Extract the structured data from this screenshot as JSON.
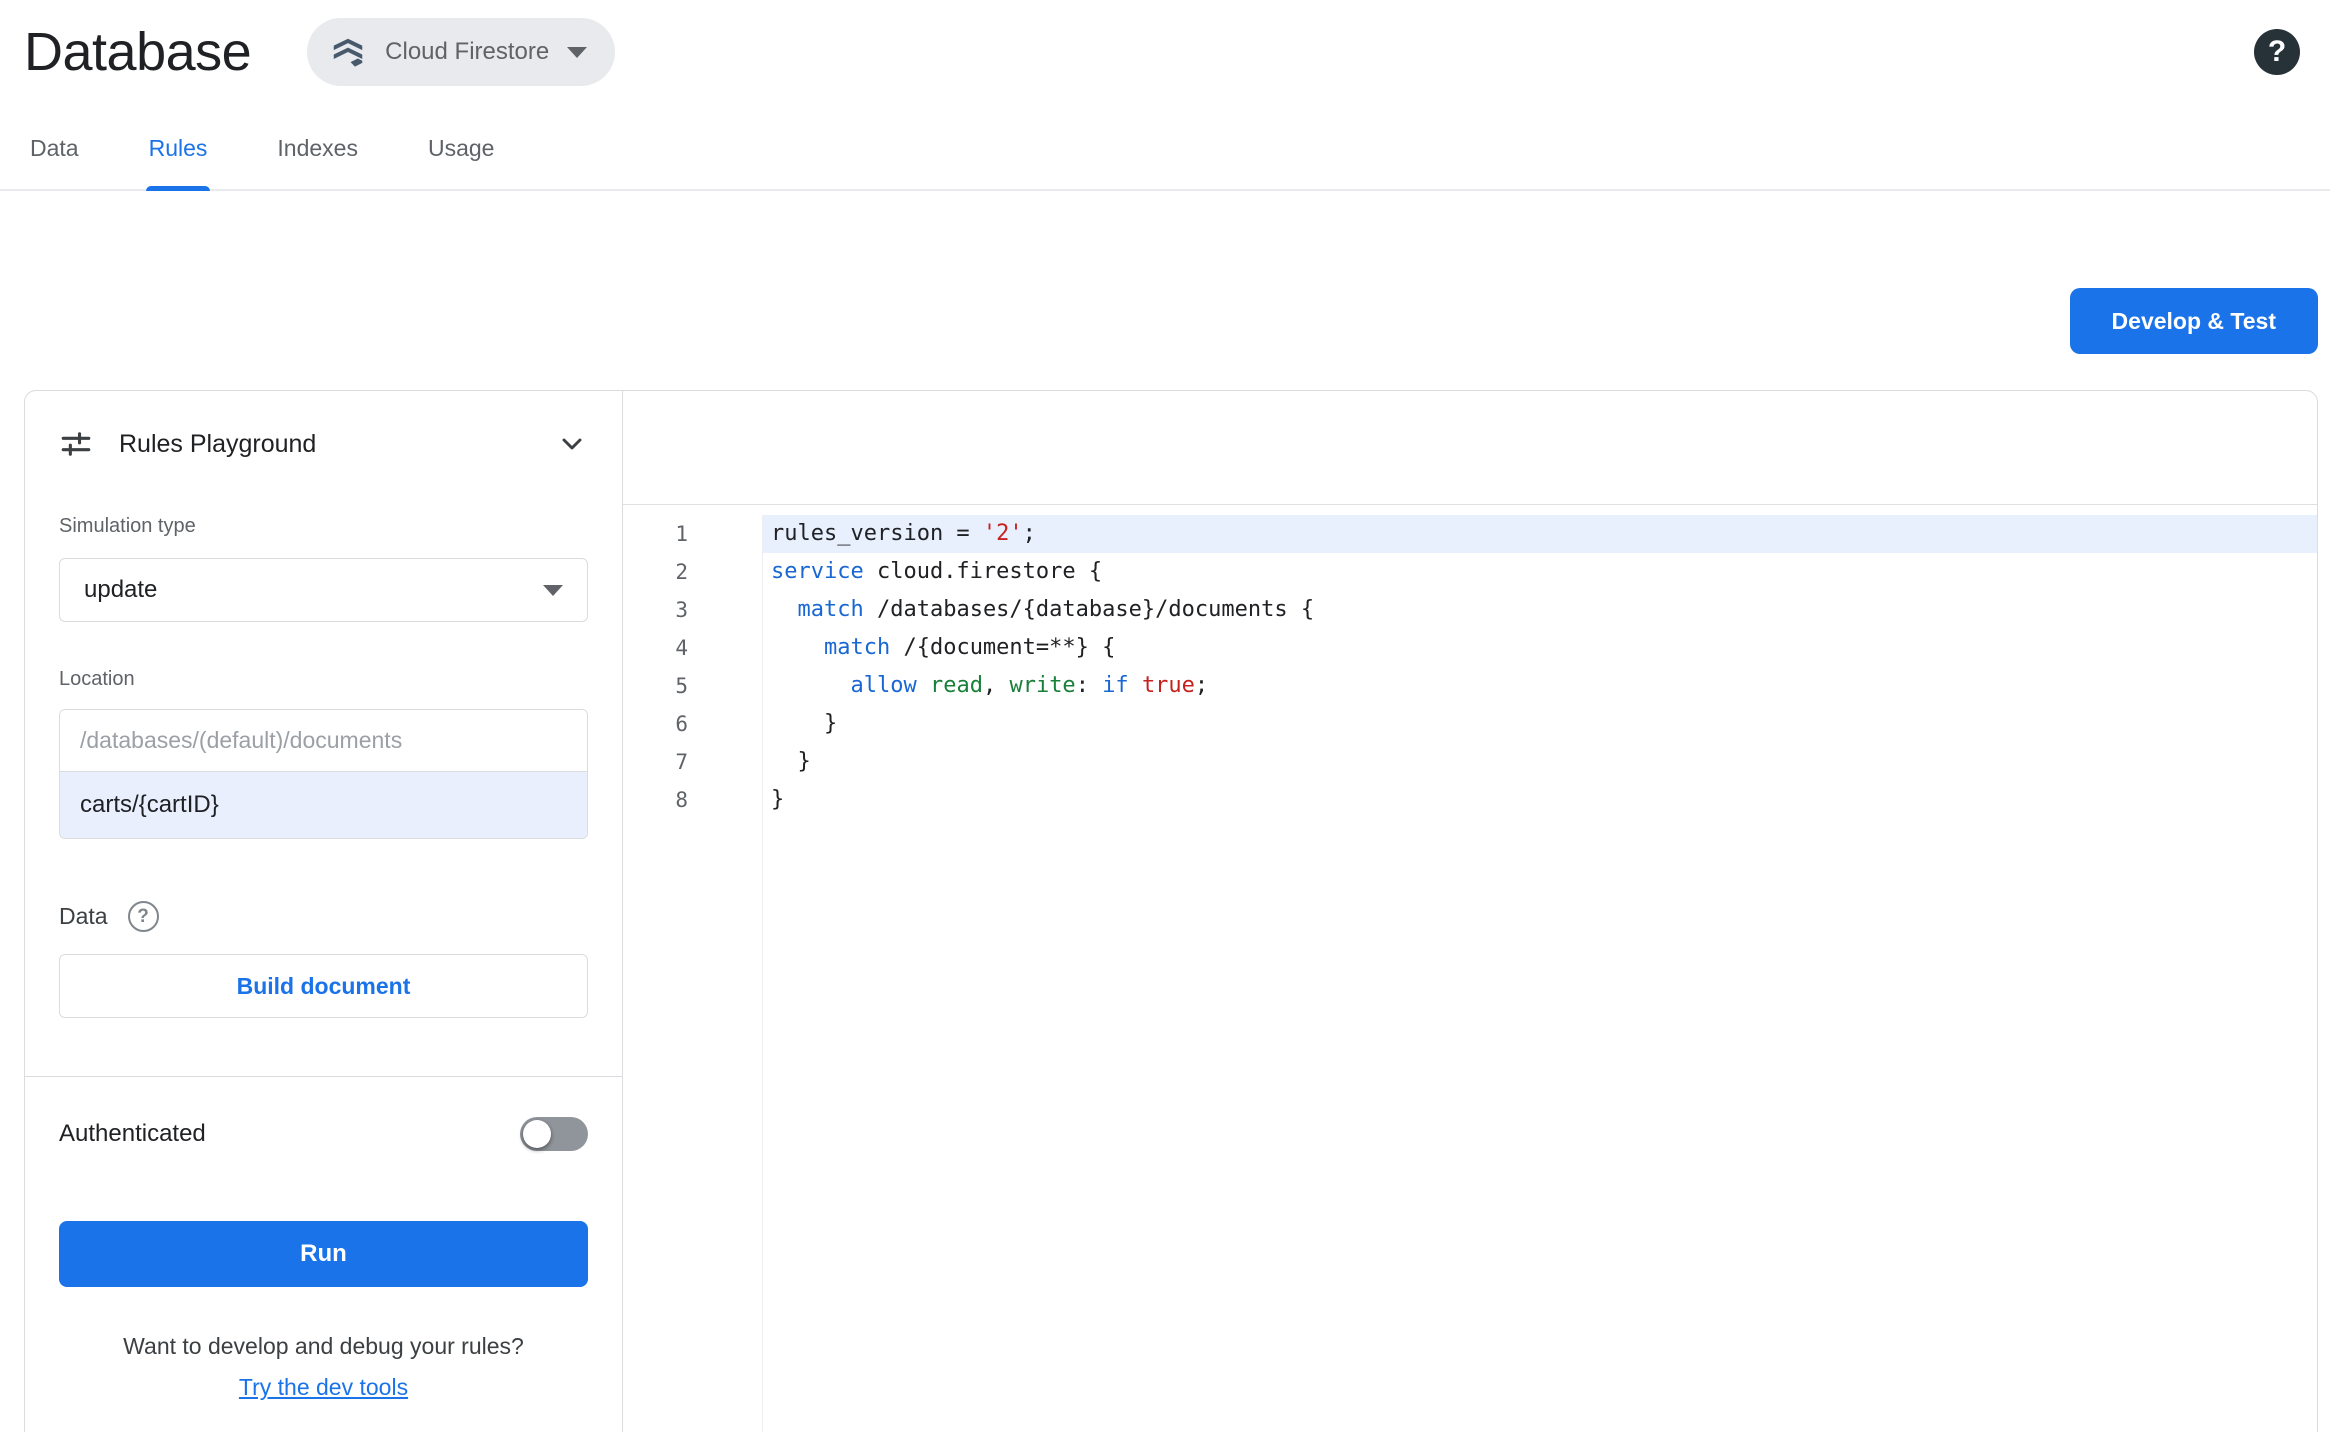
{
  "header": {
    "title": "Database",
    "chip_label": "Cloud Firestore"
  },
  "tabs": {
    "items": [
      {
        "label": "Data",
        "active": false
      },
      {
        "label": "Rules",
        "active": true
      },
      {
        "label": "Indexes",
        "active": false
      },
      {
        "label": "Usage",
        "active": false
      }
    ]
  },
  "toolbar": {
    "develop_test_label": "Develop & Test"
  },
  "playground": {
    "title": "Rules Playground",
    "simulation_type": {
      "label": "Simulation type",
      "value": "update"
    },
    "location": {
      "label": "Location",
      "placeholder": "/databases/(default)/documents",
      "value": "carts/{cartID}"
    },
    "data_section": {
      "label": "Data",
      "help_glyph": "?",
      "build_button_label": "Build document"
    },
    "authenticated": {
      "label": "Authenticated",
      "enabled": false
    },
    "run_label": "Run",
    "footer": {
      "question": "Want to develop and debug your rules?",
      "link_label": "Try the dev tools"
    }
  },
  "help_glyph": "?",
  "editor": {
    "active_line": 1,
    "token_colors": {
      "plain": "#202124",
      "keyword": "#1967d2",
      "ident": "#188038",
      "literal": "#c5221f"
    },
    "lines": [
      {
        "number": 1,
        "segments": [
          [
            "plain",
            "rules_version = "
          ],
          [
            "literal",
            "'2'"
          ],
          [
            "plain",
            ";"
          ]
        ]
      },
      {
        "number": 2,
        "segments": [
          [
            "keyword",
            "service"
          ],
          [
            "plain",
            " cloud.firestore {"
          ]
        ]
      },
      {
        "number": 3,
        "segments": [
          [
            "plain",
            "  "
          ],
          [
            "keyword",
            "match"
          ],
          [
            "plain",
            " /databases/{database}/documents {"
          ]
        ]
      },
      {
        "number": 4,
        "segments": [
          [
            "plain",
            "    "
          ],
          [
            "keyword",
            "match"
          ],
          [
            "plain",
            " /{document=**} {"
          ]
        ]
      },
      {
        "number": 5,
        "segments": [
          [
            "plain",
            "      "
          ],
          [
            "keyword",
            "allow"
          ],
          [
            "plain",
            " "
          ],
          [
            "ident",
            "read"
          ],
          [
            "plain",
            ", "
          ],
          [
            "ident",
            "write"
          ],
          [
            "plain",
            ": "
          ],
          [
            "keyword",
            "if"
          ],
          [
            "plain",
            " "
          ],
          [
            "literal",
            "true"
          ],
          [
            "plain",
            ";"
          ]
        ]
      },
      {
        "number": 6,
        "segments": [
          [
            "plain",
            "    }"
          ]
        ]
      },
      {
        "number": 7,
        "segments": [
          [
            "plain",
            "  }"
          ]
        ]
      },
      {
        "number": 8,
        "segments": [
          [
            "plain",
            "}"
          ]
        ]
      }
    ]
  },
  "colors": {
    "accent_blue": "#1a73e8",
    "active_line_bg": "#e8f0fe",
    "location_value_bg": "#e9effd",
    "border": "#dadce0"
  }
}
